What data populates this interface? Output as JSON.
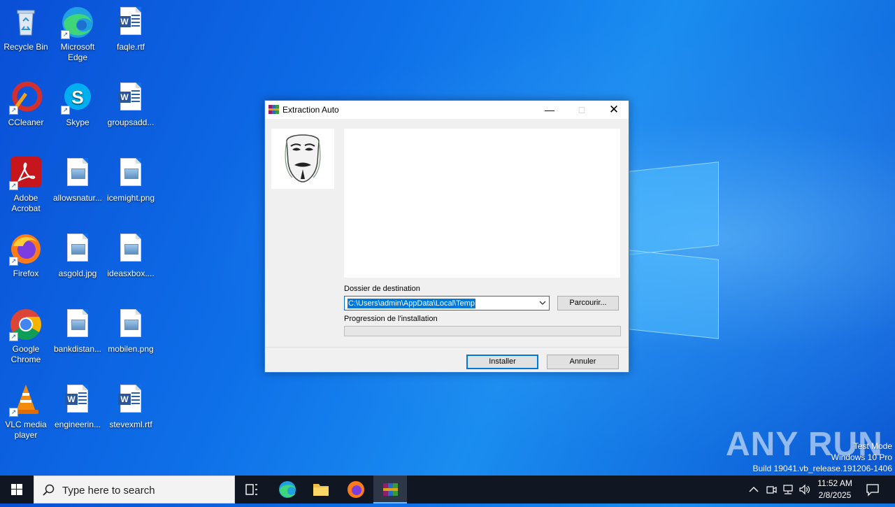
{
  "desktop": {
    "icons": [
      {
        "label": "Recycle Bin"
      },
      {
        "label": "Microsoft Edge"
      },
      {
        "label": "faqle.rtf"
      },
      {
        "label": "CCleaner"
      },
      {
        "label": "Skype"
      },
      {
        "label": "groupsadd..."
      },
      {
        "label": "Adobe Acrobat"
      },
      {
        "label": "allowsnatur..."
      },
      {
        "label": "icemight.png"
      },
      {
        "label": "Firefox"
      },
      {
        "label": "asgold.jpg"
      },
      {
        "label": "ideasxbox...."
      },
      {
        "label": "Google Chrome"
      },
      {
        "label": "bankdistan..."
      },
      {
        "label": "mobilen.png"
      },
      {
        "label": "VLC media player"
      },
      {
        "label": "engineerin..."
      },
      {
        "label": "stevexml.rtf"
      }
    ]
  },
  "dialog": {
    "title": "Extraction Auto",
    "destination_label": "Dossier de destination",
    "destination_value": "C:\\Users\\admin\\AppData\\Local\\Temp",
    "browse_label": "Parcourir...",
    "progress_label": "Progression de l'installation",
    "progress_value": 0,
    "install_label": "Installer",
    "cancel_label": "Annuler"
  },
  "watermark": {
    "brand": "ANY RUN",
    "line1": "Test Mode",
    "line2": "Windows 10 Pro",
    "line3": "Build 19041.vb_release.191206-1406"
  },
  "taskbar": {
    "search_placeholder": "Type here to search",
    "time": "11:52 AM",
    "date": "2/8/2025"
  },
  "colors": {
    "accent": "#0078d7",
    "taskbar": "#101722"
  }
}
